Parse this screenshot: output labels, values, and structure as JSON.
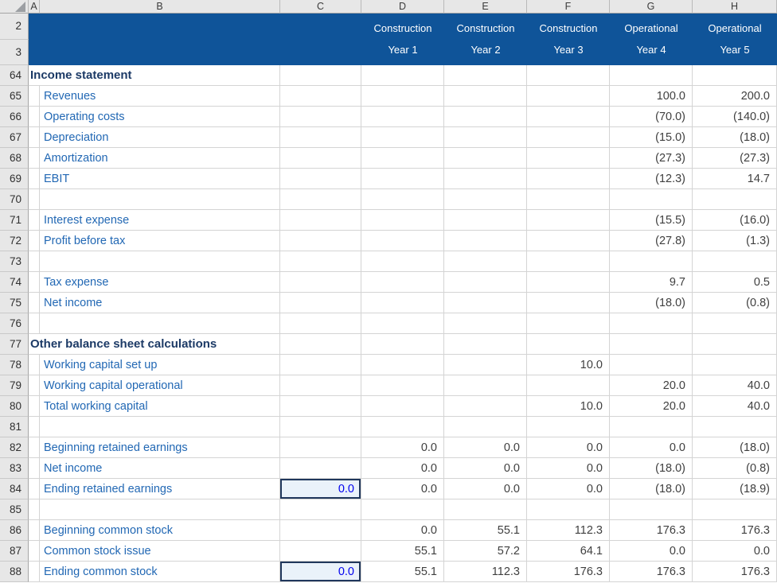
{
  "sheet": {
    "col_letters": [
      "A",
      "B",
      "C",
      "D",
      "E",
      "F",
      "G",
      "H"
    ],
    "band": {
      "row_nums": [
        "2",
        "3"
      ],
      "cols": [
        {
          "line1": "Construction",
          "line2": "Year 1"
        },
        {
          "line1": "Construction",
          "line2": "Year 2"
        },
        {
          "line1": "Construction",
          "line2": "Year 3"
        },
        {
          "line1": "Operational",
          "line2": "Year 4"
        },
        {
          "line1": "Operational",
          "line2": "Year 5"
        }
      ]
    },
    "rows": [
      {
        "num": "64",
        "type": "heading",
        "label": "Income statement",
        "values": [
          "",
          "",
          "",
          "",
          "",
          ""
        ]
      },
      {
        "num": "65",
        "type": "label",
        "label": "Revenues",
        "values": [
          "",
          "",
          "",
          "",
          "100.0",
          "200.0"
        ]
      },
      {
        "num": "66",
        "type": "label",
        "label": "Operating costs",
        "values": [
          "",
          "",
          "",
          "",
          "(70.0)",
          "(140.0)"
        ]
      },
      {
        "num": "67",
        "type": "label",
        "label": "Depreciation",
        "values": [
          "",
          "",
          "",
          "",
          "(15.0)",
          "(18.0)"
        ]
      },
      {
        "num": "68",
        "type": "label",
        "label": "Amortization",
        "values": [
          "",
          "",
          "",
          "",
          "(27.3)",
          "(27.3)"
        ]
      },
      {
        "num": "69",
        "type": "label",
        "label": "EBIT",
        "values": [
          "",
          "",
          "",
          "",
          "(12.3)",
          "14.7"
        ]
      },
      {
        "num": "70",
        "type": "blank",
        "label": "",
        "values": [
          "",
          "",
          "",
          "",
          "",
          ""
        ]
      },
      {
        "num": "71",
        "type": "label",
        "label": "Interest expense",
        "values": [
          "",
          "",
          "",
          "",
          "(15.5)",
          "(16.0)"
        ]
      },
      {
        "num": "72",
        "type": "label",
        "label": "Profit before tax",
        "values": [
          "",
          "",
          "",
          "",
          "(27.8)",
          "(1.3)"
        ]
      },
      {
        "num": "73",
        "type": "blank",
        "label": "",
        "values": [
          "",
          "",
          "",
          "",
          "",
          ""
        ]
      },
      {
        "num": "74",
        "type": "label",
        "label": "Tax expense",
        "values": [
          "",
          "",
          "",
          "",
          "9.7",
          "0.5"
        ]
      },
      {
        "num": "75",
        "type": "label",
        "label": "Net income",
        "values": [
          "",
          "",
          "",
          "",
          "(18.0)",
          "(0.8)"
        ]
      },
      {
        "num": "76",
        "type": "blank",
        "label": "",
        "values": [
          "",
          "",
          "",
          "",
          "",
          ""
        ]
      },
      {
        "num": "77",
        "type": "heading",
        "label": "Other balance sheet calculations",
        "values": [
          "",
          "",
          "",
          "",
          "",
          ""
        ]
      },
      {
        "num": "78",
        "type": "label",
        "label": "Working capital set up",
        "values": [
          "",
          "",
          "",
          "10.0",
          "",
          ""
        ]
      },
      {
        "num": "79",
        "type": "label",
        "label": "Working capital operational",
        "values": [
          "",
          "",
          "",
          "",
          "20.0",
          "40.0"
        ]
      },
      {
        "num": "80",
        "type": "label",
        "label": "Total working capital",
        "values": [
          "",
          "",
          "",
          "10.0",
          "20.0",
          "40.0"
        ]
      },
      {
        "num": "81",
        "type": "blank",
        "label": "",
        "values": [
          "",
          "",
          "",
          "",
          "",
          ""
        ]
      },
      {
        "num": "82",
        "type": "label",
        "label": "Beginning retained earnings",
        "values": [
          "",
          "0.0",
          "0.0",
          "0.0",
          "0.0",
          "(18.0)"
        ]
      },
      {
        "num": "83",
        "type": "label",
        "label": "Net income",
        "note": true,
        "values": [
          "",
          "0.0",
          "0.0",
          "0.0",
          "(18.0)",
          "(0.8)"
        ]
      },
      {
        "num": "84",
        "type": "label",
        "label": "Ending retained earnings",
        "input_col": 0,
        "values": [
          "0.0",
          "0.0",
          "0.0",
          "0.0",
          "(18.0)",
          "(18.9)"
        ]
      },
      {
        "num": "85",
        "type": "blank",
        "label": "",
        "values": [
          "",
          "",
          "",
          "",
          "",
          ""
        ]
      },
      {
        "num": "86",
        "type": "label",
        "label": "Beginning common stock",
        "values": [
          "",
          "0.0",
          "55.1",
          "112.3",
          "176.3",
          "176.3"
        ]
      },
      {
        "num": "87",
        "type": "label",
        "label": "Common stock issue",
        "values": [
          "",
          "55.1",
          "57.2",
          "64.1",
          "0.0",
          "0.0"
        ]
      },
      {
        "num": "88",
        "type": "label",
        "label": "Ending common stock",
        "input_col": 0,
        "values": [
          "0.0",
          "55.1",
          "112.3",
          "176.3",
          "176.3",
          "176.3"
        ]
      }
    ],
    "colors": {
      "band_bg": "#0F5499",
      "band_text": "#FFFFFF",
      "header_bg": "#E7E7E7",
      "gridline": "#D4D4D4",
      "heading_text": "#1C3A66",
      "label_text": "#2268B4",
      "number_text": "#3F3F3F",
      "input_text": "#0000EE",
      "input_bg": "#EAF2FA",
      "input_border": "#20375C",
      "note_red": "#E00000"
    }
  }
}
